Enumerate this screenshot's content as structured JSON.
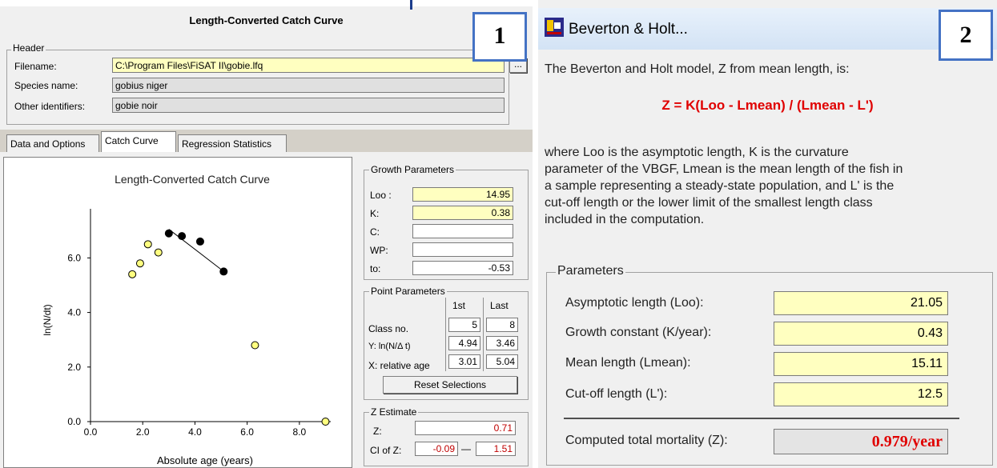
{
  "panel1": {
    "title": "Length-Converted Catch Curve",
    "badge": "1",
    "header": {
      "legend": "Header",
      "filename_label": "Filename:",
      "filename_value": "C:\\Program Files\\FiSAT II\\gobie.lfq",
      "browse_label": "...",
      "species_label": "Species name:",
      "species_value": "gobius niger",
      "other_label": "Other identifiers:",
      "other_value": "gobie noir"
    },
    "tabs": [
      "Data and Options",
      "Catch Curve",
      "Regression Statistics"
    ],
    "growth": {
      "legend": "Growth Parameters",
      "loo_label": "Loo :",
      "loo_value": "14.95",
      "k_label": "K:",
      "k_value": "0.38",
      "c_label": "C:",
      "c_value": "",
      "wp_label": "WP:",
      "wp_value": "",
      "to_label": "to:",
      "to_value": "-0.53"
    },
    "points": {
      "legend": "Point Parameters",
      "col_first": "1st",
      "col_last": "Last",
      "class_label": "Class no.",
      "class_first": "5",
      "class_last": "8",
      "y_label": "Y: ln(N/Δ t)",
      "y_first": "4.94",
      "y_last": "3.46",
      "x_label": "X: relative age",
      "x_first": "3.01",
      "x_last": "5.04",
      "reset_label": "Reset Selections"
    },
    "zest": {
      "legend": "Z Estimate",
      "z_label": "Z:",
      "z_value": "0.71",
      "ci_label": "CI of Z:",
      "ci_low": "-0.09",
      "ci_sep": "—",
      "ci_high": "1.51"
    }
  },
  "chart_data": {
    "type": "scatter",
    "title": "Length-Converted Catch Curve",
    "xlabel": "Absolute age (years)",
    "ylabel": "ln(N/dt)",
    "xlim": [
      0,
      9.2
    ],
    "ylim": [
      0,
      7.8
    ],
    "xticks": [
      "0.0",
      "2.0",
      "4.0",
      "6.0",
      "8.0"
    ],
    "yticks": [
      "0.0",
      "2.0",
      "4.0",
      "6.0"
    ],
    "xtick_values": [
      0,
      2,
      4,
      6,
      8
    ],
    "ytick_values": [
      0,
      2,
      4,
      6
    ],
    "series": [
      {
        "role": "unselected",
        "color": "#ffff80",
        "x": [
          1.6,
          1.9,
          2.2,
          2.6,
          6.3,
          9.0
        ],
        "y": [
          5.4,
          5.8,
          6.5,
          6.2,
          2.8,
          0.0
        ]
      },
      {
        "role": "selected",
        "color": "#000000",
        "x": [
          3.0,
          3.5,
          4.2,
          5.1
        ],
        "y": [
          6.9,
          6.8,
          6.6,
          5.5
        ]
      }
    ],
    "regression_line": {
      "x": [
        3.0,
        5.04
      ],
      "y": [
        7.05,
        5.55
      ]
    }
  },
  "panel2": {
    "badge": "2",
    "title": "Beverton & Holt...",
    "intro": "The Beverton and Holt model, Z from mean length, is:",
    "formula": "Z = K(Loo - Lmean) / (Lmean - L')",
    "desc_lines": [
      "where Loo is the  asymptotic length,  K is the curvature",
      "parameter of the VBGF, Lmean is the mean length  of the fish in",
      "a sample representing a steady-state population, and L' is the",
      "cut-off length or the lower limit of  the smallest length  class",
      "included in  the computation."
    ],
    "params_legend": "Parameters",
    "loo_label": "Asymptotic length (Loo):",
    "loo_value": "21.05",
    "k_label": "Growth constant (K/year):",
    "k_value": "0.43",
    "lmean_label": "Mean length (Lmean):",
    "lmean_value": "15.11",
    "lc_label": "Cut-off length (L'):",
    "lc_value": "12.5",
    "z_label": "Computed total mortality (Z):",
    "z_value": "0.979/year",
    "accent_red": "#e00000"
  }
}
